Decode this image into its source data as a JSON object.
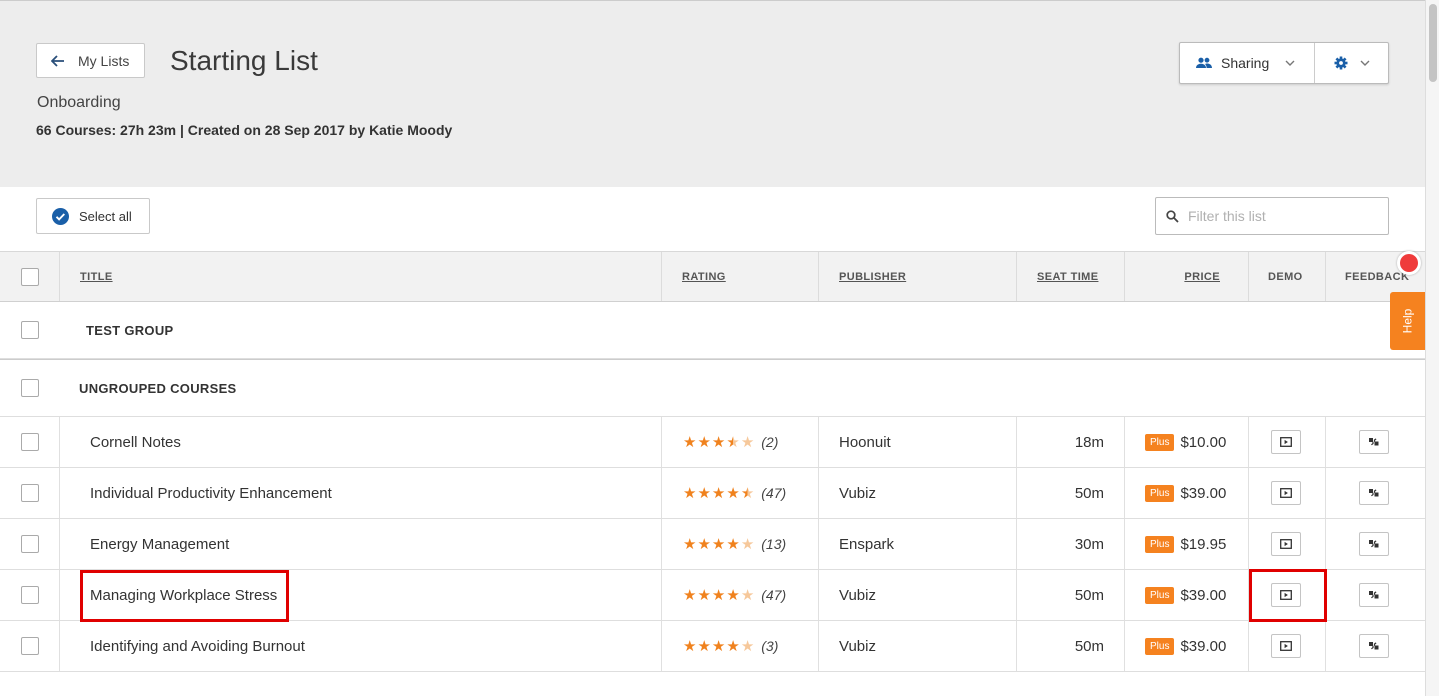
{
  "header": {
    "back_label": "My Lists",
    "title": "Starting List",
    "subtitle": "Onboarding",
    "meta": "66 Courses: 27h 23m | Created on 28 Sep 2017 by Katie Moody",
    "sharing_label": "Sharing"
  },
  "toolbar": {
    "select_all_label": "Select all",
    "filter_placeholder": "Filter this list"
  },
  "columns": {
    "title": "TITLE",
    "rating": "RATING",
    "publisher": "PUBLISHER",
    "seat_time": "SEAT TIME",
    "price": "PRICE",
    "demo": "DEMO",
    "feedback": "FEEDBACK"
  },
  "groups": [
    "TEST GROUP",
    "UNGROUPED COURSES"
  ],
  "courses": [
    {
      "title": "Cornell Notes",
      "rating": 3.5,
      "rating_count": "(2)",
      "publisher": "Hoonuit",
      "seat_time": "18m",
      "badge": "Plus",
      "price": "$10.00"
    },
    {
      "title": "Individual Productivity Enhancement",
      "rating": 4.5,
      "rating_count": "(47)",
      "publisher": "Vubiz",
      "seat_time": "50m",
      "badge": "Plus",
      "price": "$39.00"
    },
    {
      "title": "Energy Management",
      "rating": 4,
      "rating_count": "(13)",
      "publisher": "Enspark",
      "seat_time": "30m",
      "badge": "Plus",
      "price": "$19.95"
    },
    {
      "title": "Managing Workplace Stress",
      "rating": 4,
      "rating_count": "(47)",
      "publisher": "Vubiz",
      "seat_time": "50m",
      "badge": "Plus",
      "price": "$39.00"
    },
    {
      "title": "Identifying and Avoiding Burnout",
      "rating": 4,
      "rating_count": "(3)",
      "publisher": "Vubiz",
      "seat_time": "50m",
      "badge": "Plus",
      "price": "$39.00"
    }
  ],
  "help_label": "Help",
  "colors": {
    "accent": "#f5821f",
    "highlight": "#e00000",
    "check": "#1a5fa8"
  }
}
